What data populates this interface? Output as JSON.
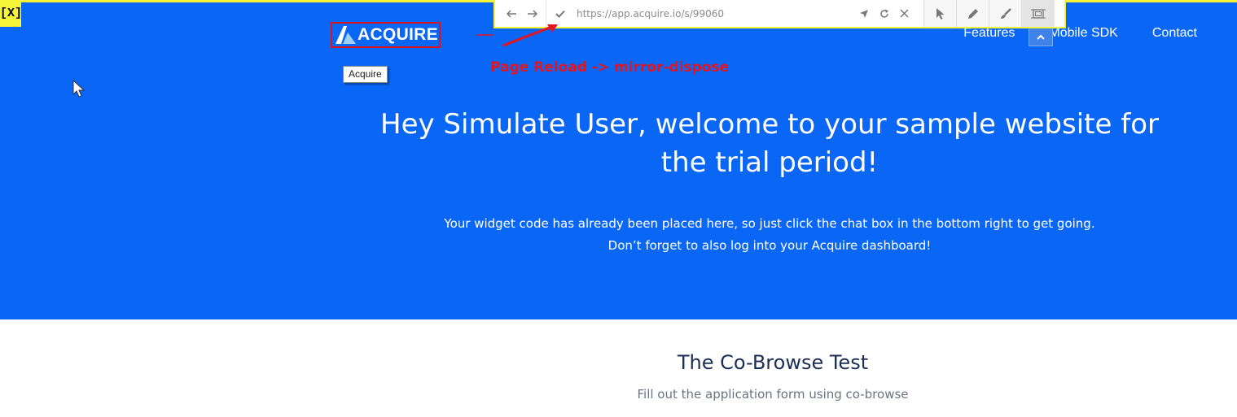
{
  "window": {
    "close_label": "[X]"
  },
  "logo": {
    "text": "ACQUIRE",
    "tooltip": "Acquire"
  },
  "toolbar": {
    "back_icon": "arrow-left-icon",
    "forward_icon": "arrow-right-icon",
    "status_icon": "checkmark-icon",
    "url": "https://app.acquire.io/s/99060",
    "locate_icon": "location-arrow-icon",
    "reload_icon": "reload-icon",
    "close_icon": "close-icon",
    "tools": [
      "pointer-tool",
      "pencil-tool",
      "brush-tool",
      "screen-select-tool"
    ]
  },
  "nav": {
    "items": [
      "Features",
      "Mobile SDK",
      "Contact"
    ]
  },
  "annotation": {
    "text": "Page Reload -> mirror-dispose"
  },
  "hero": {
    "headline": "Hey Simulate User, welcome to your sample website for the trial period!",
    "line1": "Your widget code has already been placed here, so just click the chat box in the bottom right to get going.",
    "line2": "Don’t forget to also log into your Acquire dashboard!"
  },
  "section": {
    "title": "The Co-Browse Test",
    "subtitle": "Fill out the application form using co-browse"
  },
  "colors": {
    "hero_bg": "#0a66f5",
    "highlight": "#f5f53a",
    "annotation": "#e8141c"
  }
}
